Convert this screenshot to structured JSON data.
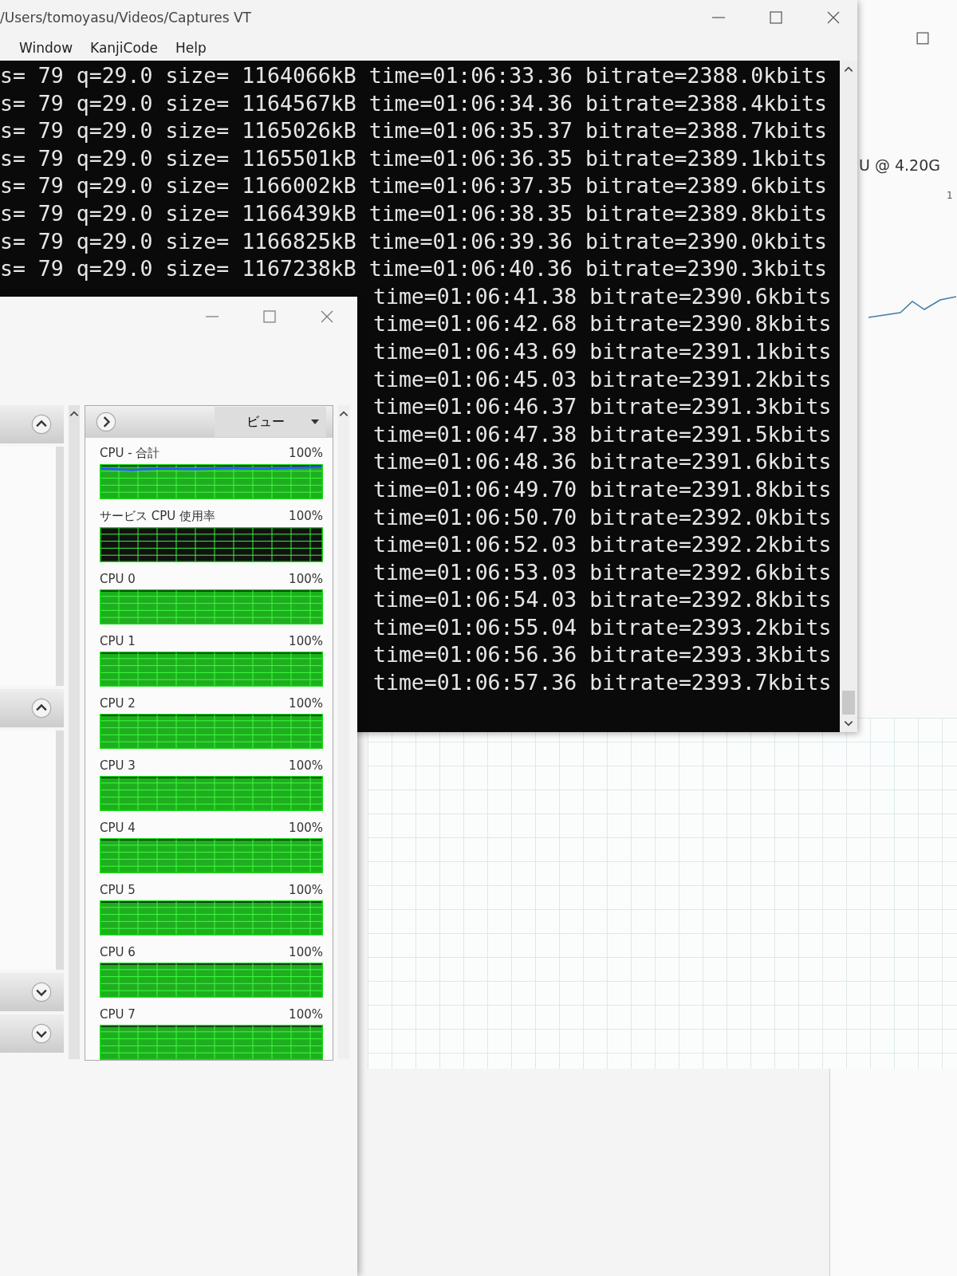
{
  "terminal": {
    "title": "/Users/tomoyasu/Videos/Captures VT",
    "menu": [
      "Window",
      "KanjiCode",
      "Help"
    ],
    "lines": [
      {
        "kind": "full",
        "text": "s= 79 q=29.0 size= 1164066kB time=01:06:33.36 bitrate=2388.0kbits"
      },
      {
        "kind": "full",
        "text": "s= 79 q=29.0 size= 1164567kB time=01:06:34.36 bitrate=2388.4kbits"
      },
      {
        "kind": "full",
        "text": "s= 79 q=29.0 size= 1165026kB time=01:06:35.37 bitrate=2388.7kbits"
      },
      {
        "kind": "full",
        "text": "s= 79 q=29.0 size= 1165501kB time=01:06:36.35 bitrate=2389.1kbits"
      },
      {
        "kind": "full",
        "text": "s= 79 q=29.0 size= 1166002kB time=01:06:37.35 bitrate=2389.6kbits"
      },
      {
        "kind": "full",
        "text": "s= 79 q=29.0 size= 1166439kB time=01:06:38.35 bitrate=2389.8kbits"
      },
      {
        "kind": "full",
        "text": "s= 79 q=29.0 size= 1166825kB time=01:06:39.36 bitrate=2390.0kbits"
      },
      {
        "kind": "full",
        "text": "s= 79 q=29.0 size= 1167238kB time=01:06:40.36 bitrate=2390.3kbits"
      },
      {
        "kind": "partial",
        "text": "time=01:06:41.38 bitrate=2390.6kbits"
      },
      {
        "kind": "partial",
        "text": "time=01:06:42.68 bitrate=2390.8kbits"
      },
      {
        "kind": "partial",
        "text": "time=01:06:43.69 bitrate=2391.1kbits"
      },
      {
        "kind": "partial",
        "text": "time=01:06:45.03 bitrate=2391.2kbits"
      },
      {
        "kind": "partial",
        "text": "time=01:06:46.37 bitrate=2391.3kbits"
      },
      {
        "kind": "partial",
        "text": "time=01:06:47.38 bitrate=2391.5kbits"
      },
      {
        "kind": "partial",
        "text": "time=01:06:48.36 bitrate=2391.6kbits"
      },
      {
        "kind": "partial",
        "text": "time=01:06:49.70 bitrate=2391.8kbits"
      },
      {
        "kind": "partial",
        "text": "time=01:06:50.70 bitrate=2392.0kbits"
      },
      {
        "kind": "partial",
        "text": "time=01:06:52.03 bitrate=2392.2kbits"
      },
      {
        "kind": "partial",
        "text": "time=01:06:53.03 bitrate=2392.6kbits"
      },
      {
        "kind": "partial",
        "text": "time=01:06:54.03 bitrate=2392.8kbits"
      },
      {
        "kind": "partial",
        "text": "time=01:06:55.04 bitrate=2393.2kbits"
      },
      {
        "kind": "partial",
        "text": "time=01:06:56.36 bitrate=2393.3kbits"
      },
      {
        "kind": "partial",
        "text": "time=01:06:57.36 bitrate=2393.7kbits"
      }
    ]
  },
  "resource_monitor": {
    "view_button": "ビュー",
    "graphs": [
      {
        "kind": "total",
        "label": "CPU - 合計",
        "value": "100%"
      },
      {
        "kind": "service",
        "label": "サービス CPU 使用率",
        "value": "100%"
      },
      {
        "kind": "cpu",
        "label": "CPU 0",
        "value": "100%"
      },
      {
        "kind": "cpu",
        "label": "CPU 1",
        "value": "100%"
      },
      {
        "kind": "cpu",
        "label": "CPU 2",
        "value": "100%"
      },
      {
        "kind": "cpu",
        "label": "CPU 3",
        "value": "100%"
      },
      {
        "kind": "cpu",
        "label": "CPU 4",
        "value": "100%"
      },
      {
        "kind": "cpu",
        "label": "CPU 5",
        "value": "100%"
      },
      {
        "kind": "cpu",
        "label": "CPU 6",
        "value": "100%"
      },
      {
        "kind": "cpu",
        "label": "CPU 7",
        "value": "100%"
      }
    ]
  },
  "background_window": {
    "processor_text": "U @ 4.20G",
    "axis_text": "1"
  }
}
